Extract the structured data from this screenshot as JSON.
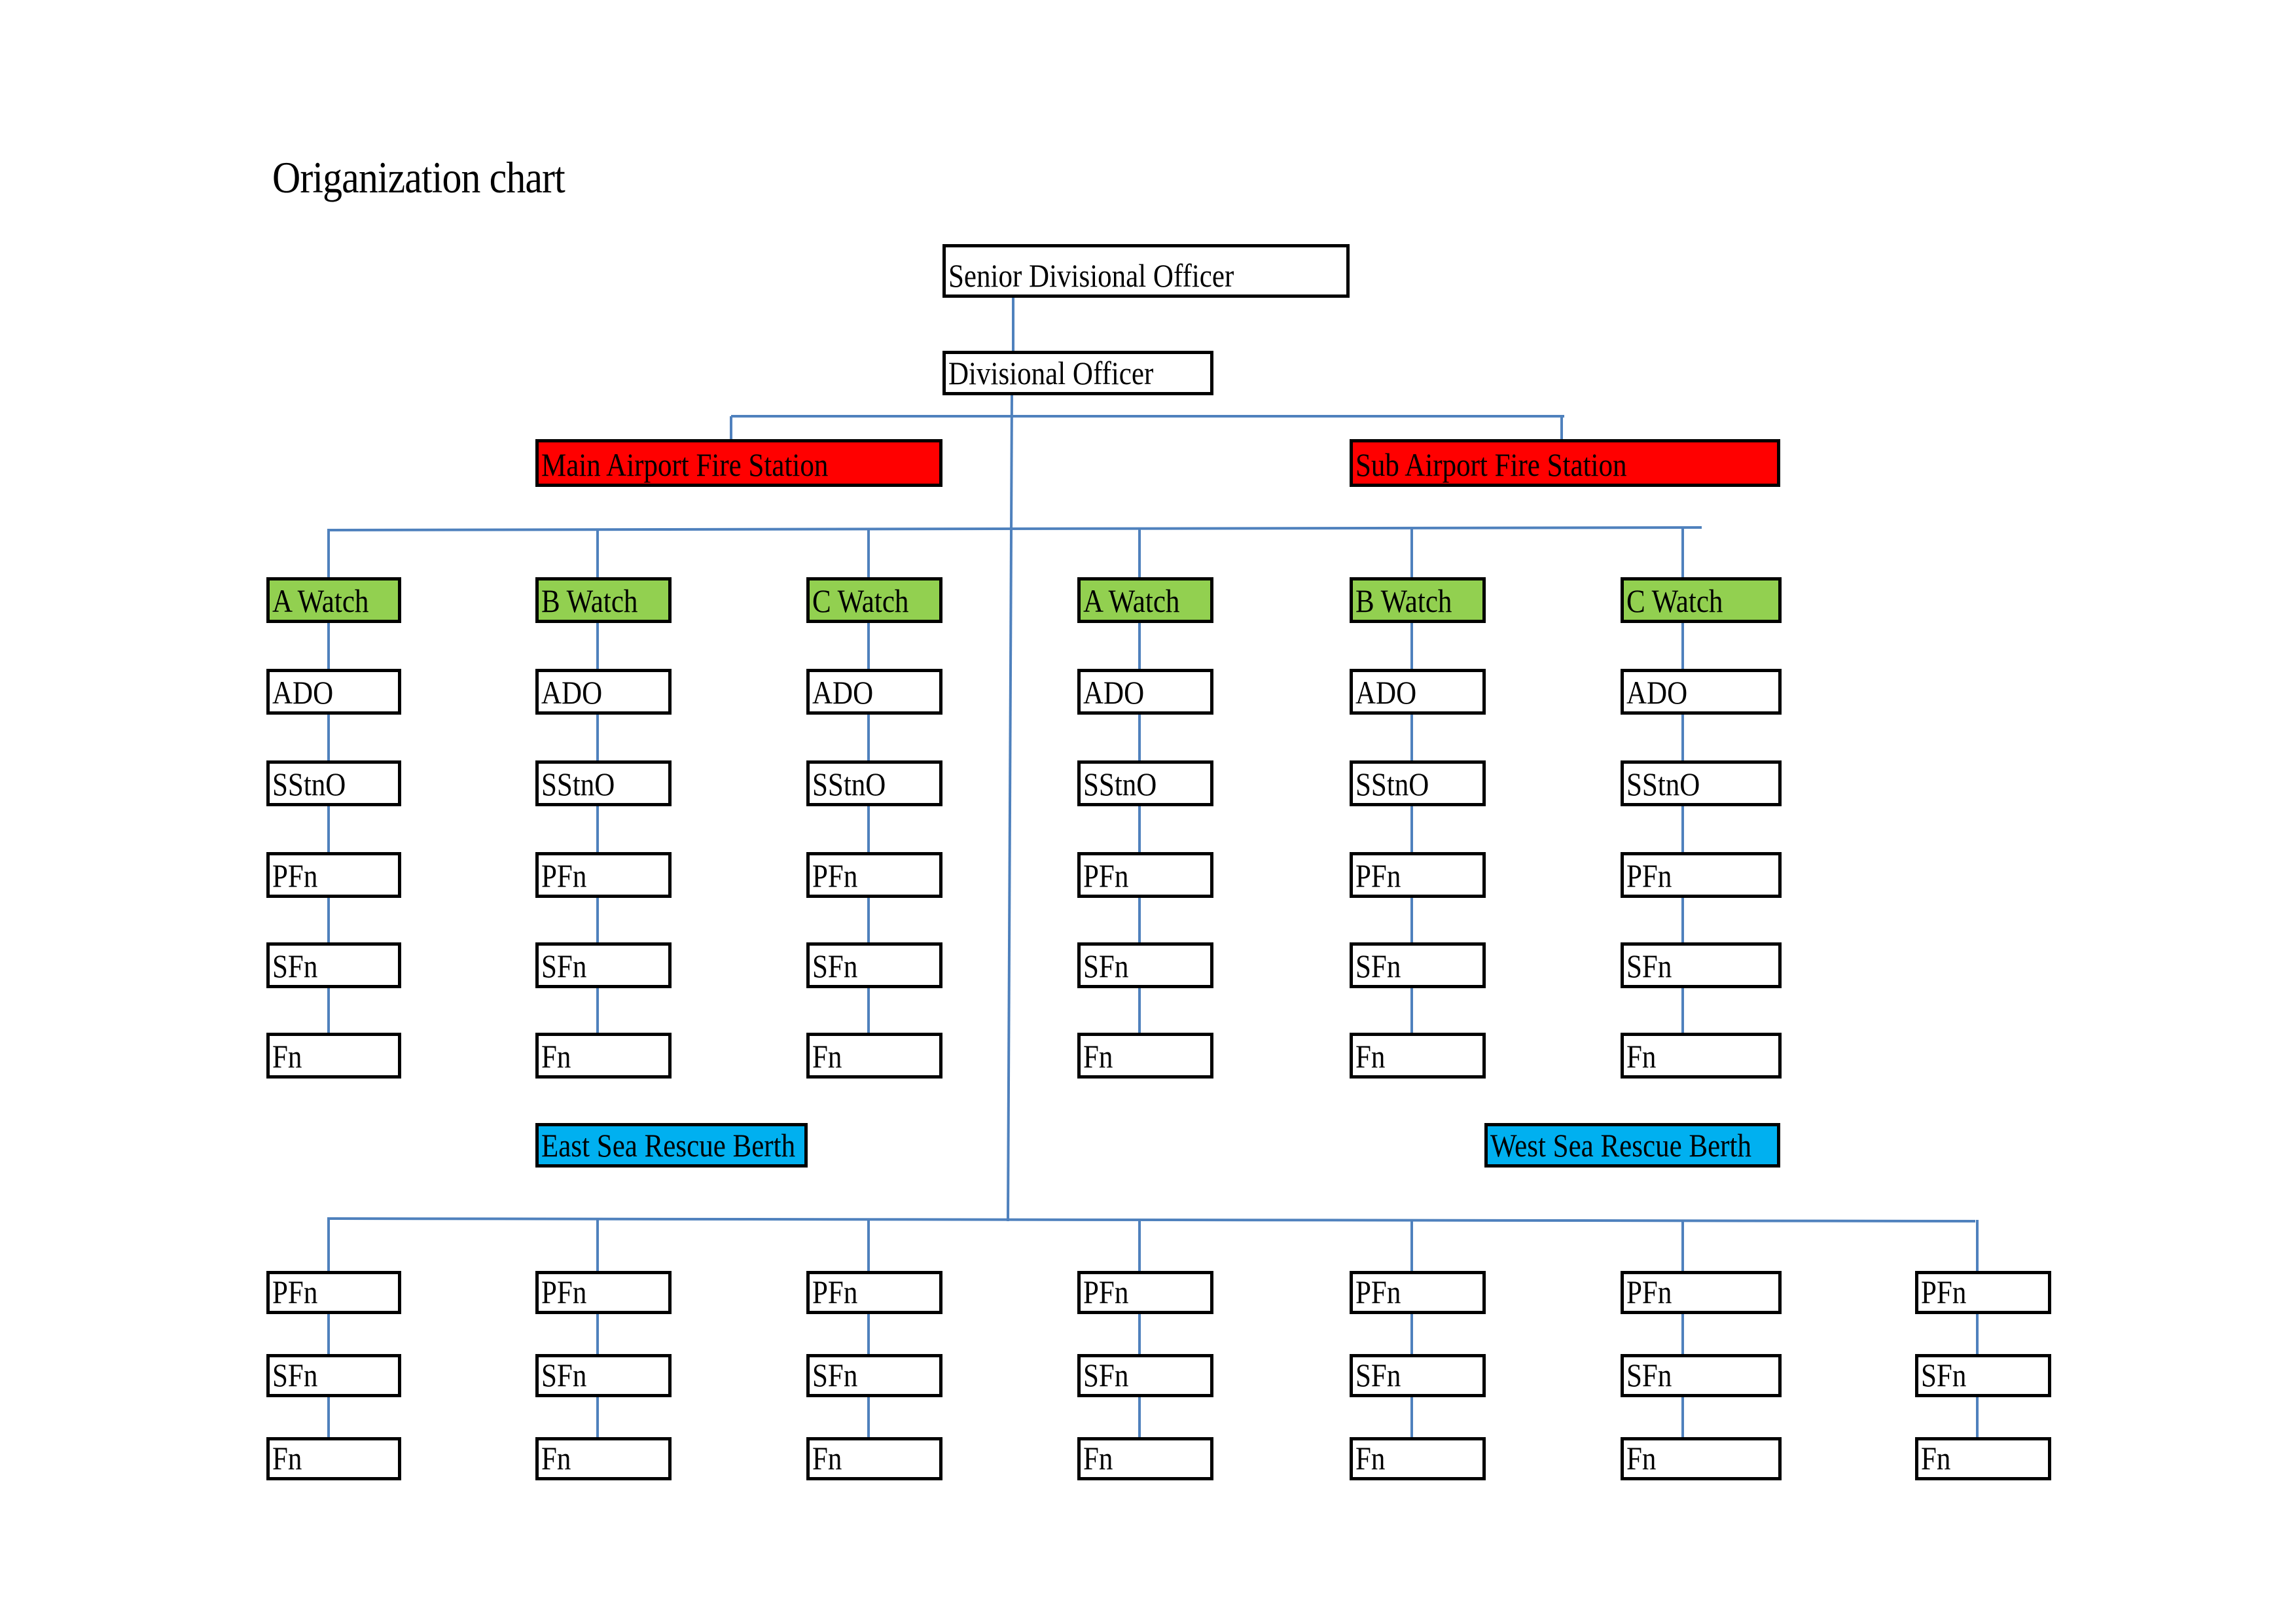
{
  "title": "Origanization chart",
  "top": {
    "senior": "Senior Divisional Officer",
    "divisional": "Divisional Officer"
  },
  "stations": [
    {
      "name": "Main Airport Fire Station",
      "color": "#ff0000"
    },
    {
      "name": "Sub Airport Fire Station",
      "color": "#ff0000"
    }
  ],
  "watches": [
    {
      "station": "Main Airport Fire Station",
      "name": "A Watch",
      "ranks": [
        "ADO",
        "SStnO",
        "PFn",
        "SFn",
        "Fn"
      ]
    },
    {
      "station": "Main Airport Fire Station",
      "name": "B Watch",
      "ranks": [
        "ADO",
        "SStnO",
        "PFn",
        "SFn",
        "Fn"
      ]
    },
    {
      "station": "Main Airport Fire Station",
      "name": "C Watch",
      "ranks": [
        "ADO",
        "SStnO",
        "PFn",
        "SFn",
        "Fn"
      ]
    },
    {
      "station": "Sub Airport Fire Station",
      "name": "A Watch",
      "ranks": [
        "ADO",
        "SStnO",
        "PFn",
        "SFn",
        "Fn"
      ]
    },
    {
      "station": "Sub Airport Fire Station",
      "name": "B Watch",
      "ranks": [
        "ADO",
        "SStnO",
        "PFn",
        "SFn",
        "Fn"
      ]
    },
    {
      "station": "Sub Airport Fire Station",
      "name": "C Watch",
      "ranks": [
        "ADO",
        "SStnO",
        "PFn",
        "SFn",
        "Fn"
      ]
    }
  ],
  "watch_color": "#92d050",
  "berths": [
    {
      "name": "East Sea Rescue Berth",
      "color": "#00b0f0"
    },
    {
      "name": "West Sea Rescue Berth",
      "color": "#00b0f0"
    }
  ],
  "berth_crews": [
    {
      "ranks": [
        "PFn",
        "SFn",
        "Fn"
      ]
    },
    {
      "ranks": [
        "PFn",
        "SFn",
        "Fn"
      ]
    },
    {
      "ranks": [
        "PFn",
        "SFn",
        "Fn"
      ]
    },
    {
      "ranks": [
        "PFn",
        "SFn",
        "Fn"
      ]
    },
    {
      "ranks": [
        "PFn",
        "SFn",
        "Fn"
      ]
    },
    {
      "ranks": [
        "PFn",
        "SFn",
        "Fn"
      ]
    },
    {
      "ranks": [
        "PFn",
        "SFn",
        "Fn"
      ]
    }
  ],
  "connector_color": "#4f81bd"
}
